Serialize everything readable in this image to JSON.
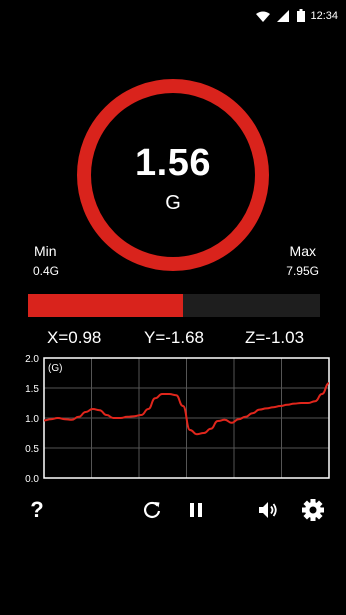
{
  "status_bar": {
    "time": "12:34"
  },
  "reading": {
    "value": "1.56",
    "unit": "G"
  },
  "min": {
    "label": "Min",
    "value": "0.4G"
  },
  "max": {
    "label": "Max",
    "value": "7.95G"
  },
  "level": {
    "fraction": 0.53
  },
  "axes": {
    "x": "X=0.98",
    "y": "Y=-1.68",
    "z": "Z=-1.03"
  },
  "chart_data": {
    "type": "line",
    "ylabel": "(G)",
    "ylim": [
      0,
      2.0
    ],
    "yticks": [
      "0.0",
      "0.5",
      "1.0",
      "1.5",
      "2.0"
    ],
    "grid": true,
    "color": "#e0261c",
    "series": [
      {
        "values": [
          0.96,
          0.98,
          1.0,
          0.98,
          0.97,
          1.02,
          1.1,
          1.15,
          1.13,
          1.05,
          1.0,
          1.0,
          1.02,
          1.03,
          1.05,
          1.15,
          1.33,
          1.4,
          1.4,
          1.38,
          1.2,
          0.8,
          0.73,
          0.75,
          0.82,
          0.95,
          0.97,
          0.92,
          0.98,
          1.02,
          1.08,
          1.14,
          1.16,
          1.18,
          1.2,
          1.22,
          1.24,
          1.25,
          1.25,
          1.28,
          1.4,
          1.58
        ]
      }
    ]
  },
  "toolbar": {
    "help_label": "?",
    "refresh_icon": "refresh-icon",
    "pause_icon": "pause-icon",
    "sound_icon": "volume-icon",
    "settings_icon": "gear-icon"
  },
  "colors": {
    "accent": "#d9231c",
    "background": "#000000",
    "bar_track": "#1e1e1e"
  }
}
